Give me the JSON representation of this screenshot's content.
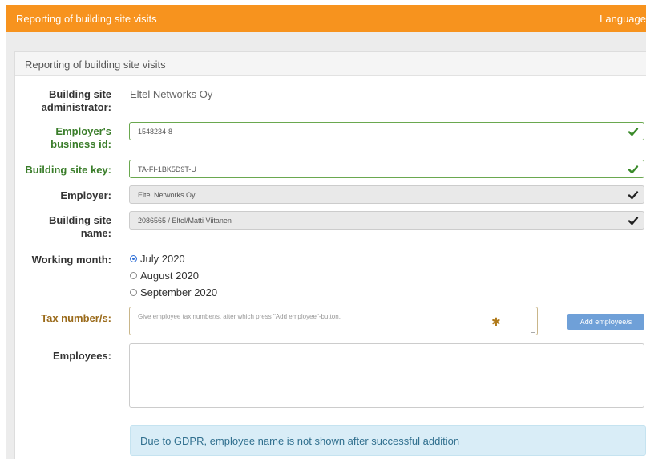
{
  "topbar": {
    "title": "Reporting of building site visits",
    "language": "Language"
  },
  "panel": {
    "heading": "Reporting of building site visits"
  },
  "form": {
    "administrator": {
      "label_line1": "Building site",
      "label_line2": "administrator:",
      "value": "Eltel Networks Oy"
    },
    "business_id": {
      "label_line1": "Employer's",
      "label_line2": "business id:",
      "value": "1548234-8"
    },
    "site_key": {
      "label": "Building site key:",
      "value": "TA-FI-1BK5D9T-U"
    },
    "employer": {
      "label": "Employer:",
      "value": "Eltel Networks Oy"
    },
    "site_name": {
      "label_line1": "Building site",
      "label_line2": "name:",
      "value": "2086565 / Eltel/Matti Viitanen"
    },
    "working_month": {
      "label": "Working month:",
      "options": [
        "July 2020",
        "August 2020",
        "September 2020"
      ],
      "selected": "July 2020"
    },
    "tax_numbers": {
      "label": "Tax number/s:",
      "placeholder": "Give employee tax number/s. after which press \"Add employee\"-button.",
      "add_button": "Add employee/s"
    },
    "employees": {
      "label": "Employees:"
    }
  },
  "info_message": "Due to GDPR, employee name is not shown after successful addition",
  "colors": {
    "topbar": "#f7931e",
    "valid": "#3a7d2a",
    "info_bg": "#d9edf7",
    "button": "#6fa0d8"
  }
}
